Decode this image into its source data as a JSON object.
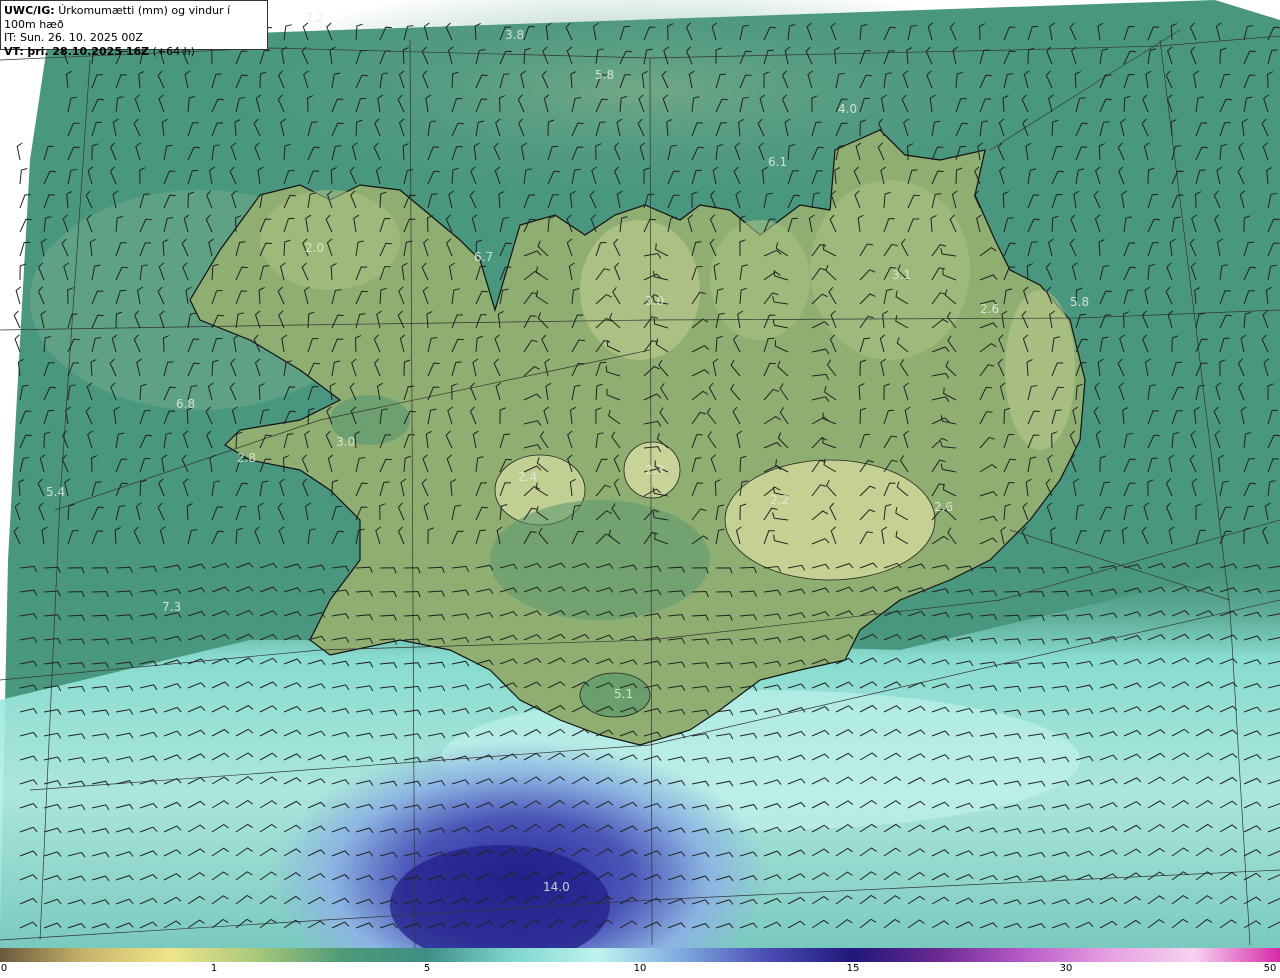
{
  "header": {
    "model": "UWC/IG:",
    "product": "Úrkomumætti (mm) og vindur í 100m hæð",
    "init_time": "IT: Sun. 26. 10. 2025 00Z",
    "valid_prefix": "VT:",
    "valid_time": "þri. 28.10.2025 16Z",
    "lead": "(+64 h)"
  },
  "colorbar": {
    "ticks": [
      "0",
      "1",
      "5",
      "10",
      "15",
      "30",
      "50"
    ],
    "colors": [
      "#6b5a3e",
      "#c7b56a",
      "#f0e48a",
      "#a8c97a",
      "#4f9a78",
      "#3d8f86",
      "#7fd6cf",
      "#bff3ef",
      "#7ea8df",
      "#4a4cb3",
      "#21177a",
      "#6a2a92",
      "#b85bc8",
      "#e7a0e2",
      "#f6d2f0",
      "#d62aa8"
    ]
  },
  "map_values": [
    "7.2",
    "3.8",
    "5.8",
    "4.0",
    "6.1",
    "2.0",
    "6.7",
    "3.1",
    "3.0",
    "5.8",
    "2.6",
    "6.8",
    "3.0",
    "2.8",
    "5.4",
    "2.3",
    "2.4",
    "2.2",
    "2.6",
    "7.3",
    "5.1",
    "14.0"
  ],
  "colors": {
    "land": "#8fb07a",
    "sea": "#4f9a82",
    "heavy_rain": "#3a3ca8",
    "coast": "#111111"
  }
}
